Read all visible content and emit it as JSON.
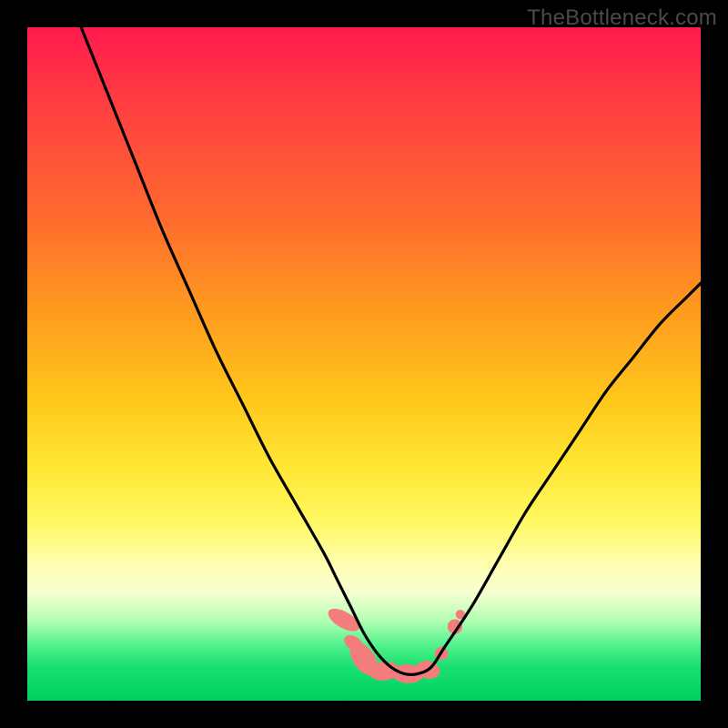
{
  "watermark": "TheBottleneck.com",
  "chart_data": {
    "type": "line",
    "title": "",
    "xlabel": "",
    "ylabel": "",
    "xlim": [
      0,
      100
    ],
    "ylim": [
      0,
      100
    ],
    "series": [
      {
        "name": "curve",
        "color": "#000000",
        "x": [
          8,
          12,
          16,
          20,
          24,
          28,
          32,
          36,
          40,
          44,
          46,
          48,
          50,
          52,
          54,
          56,
          58,
          60,
          62,
          66,
          70,
          74,
          78,
          82,
          86,
          90,
          94,
          98,
          100
        ],
        "y": [
          100,
          90,
          80,
          70,
          61,
          52,
          44,
          36,
          29,
          22,
          18,
          14,
          10,
          7,
          5,
          4,
          4,
          5,
          8,
          14,
          21,
          28,
          34,
          40,
          46,
          51,
          56,
          60,
          62
        ]
      }
    ],
    "markers": [
      {
        "shape": "pill",
        "cx": 47.0,
        "cy": 12.0,
        "rx": 1.2,
        "ry": 2.6,
        "angle": -60,
        "color": "#f37d7d"
      },
      {
        "shape": "pill",
        "cx": 48.5,
        "cy": 8.5,
        "rx": 1.0,
        "ry": 1.6,
        "angle": -55,
        "color": "#f37d7d"
      },
      {
        "shape": "pill",
        "cx": 50.0,
        "cy": 6.2,
        "rx": 1.6,
        "ry": 2.8,
        "angle": -35,
        "color": "#f37d7d"
      },
      {
        "shape": "pill",
        "cx": 53.0,
        "cy": 4.4,
        "rx": 2.2,
        "ry": 1.4,
        "angle": -8,
        "color": "#f37d7d"
      },
      {
        "shape": "pill",
        "cx": 56.5,
        "cy": 4.0,
        "rx": 2.4,
        "ry": 1.4,
        "angle": 2,
        "color": "#f37d7d"
      },
      {
        "shape": "pill",
        "cx": 59.5,
        "cy": 4.6,
        "rx": 1.8,
        "ry": 1.3,
        "angle": 15,
        "color": "#f37d7d"
      },
      {
        "shape": "circle",
        "cx": 61.5,
        "cy": 7.0,
        "r": 1.0,
        "color": "#f37d7d"
      },
      {
        "shape": "circle",
        "cx": 63.5,
        "cy": 11.0,
        "r": 1.1,
        "color": "#f37d7d"
      },
      {
        "shape": "circle",
        "cx": 64.3,
        "cy": 12.8,
        "r": 0.7,
        "color": "#f37d7d"
      }
    ]
  }
}
